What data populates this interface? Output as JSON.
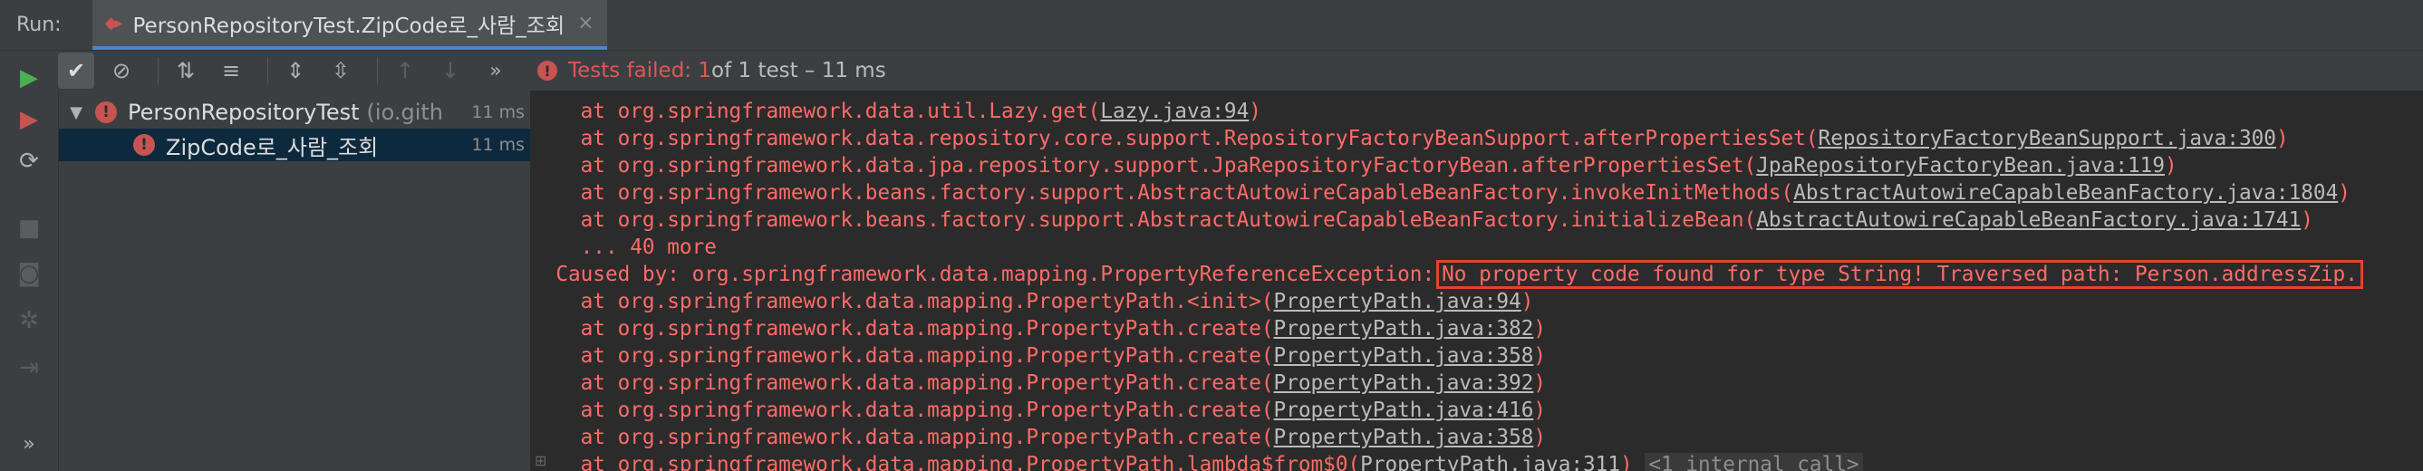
{
  "tabbar": {
    "run_label": "Run:",
    "tab_title": "PersonRepositoryTest.ZipCode로_사람_조회",
    "tab_close": "×"
  },
  "toolbar": {
    "more": "»",
    "status_failed": "Tests failed: 1",
    "status_rest": " of 1 test – 11 ms"
  },
  "leftbar": {
    "more": "»"
  },
  "tree": {
    "root": {
      "name": "PersonRepositoryTest",
      "pkg": "(io.gith",
      "time": "11 ms"
    },
    "child": {
      "name": "ZipCode로_사람_조회",
      "time": "11 ms"
    }
  },
  "console": {
    "lines": [
      {
        "pre": "    at org.springframework.data.util.Lazy.get(",
        "link": "Lazy.java:94",
        "post": ")"
      },
      {
        "pre": "    at org.springframework.data.repository.core.support.RepositoryFactoryBeanSupport.afterPropertiesSet(",
        "link": "RepositoryFactoryBeanSupport.java:300",
        "post": ")"
      },
      {
        "pre": "    at org.springframework.data.jpa.repository.support.JpaRepositoryFactoryBean.afterPropertiesSet(",
        "link": "JpaRepositoryFactoryBean.java:119",
        "post": ")"
      },
      {
        "pre": "    at org.springframework.beans.factory.support.AbstractAutowireCapableBeanFactory.invokeInitMethods(",
        "link": "AbstractAutowireCapableBeanFactory.java:1804",
        "post": ")"
      },
      {
        "pre": "    at org.springframework.beans.factory.support.AbstractAutowireCapableBeanFactory.initializeBean(",
        "link": "AbstractAutowireCapableBeanFactory.java:1741",
        "post": ")"
      },
      {
        "pre": "    ... 40 more",
        "link": "",
        "post": ""
      }
    ],
    "caused_by_prefix": "  Caused by: org.springframework.data.mapping.PropertyReferenceException:",
    "caused_by_message": "No property code found for type String! Traversed path: Person.addressZip.",
    "lines2": [
      {
        "pre": "    at org.springframework.data.mapping.PropertyPath.<init>(",
        "link": "PropertyPath.java:94",
        "post": ")"
      },
      {
        "pre": "    at org.springframework.data.mapping.PropertyPath.create(",
        "link": "PropertyPath.java:382",
        "post": ")"
      },
      {
        "pre": "    at org.springframework.data.mapping.PropertyPath.create(",
        "link": "PropertyPath.java:358",
        "post": ")"
      },
      {
        "pre": "    at org.springframework.data.mapping.PropertyPath.create(",
        "link": "PropertyPath.java:392",
        "post": ")"
      },
      {
        "pre": "    at org.springframework.data.mapping.PropertyPath.create(",
        "link": "PropertyPath.java:416",
        "post": ")"
      },
      {
        "pre": "    at org.springframework.data.mapping.PropertyPath.create(",
        "link": "PropertyPath.java:358",
        "post": ")"
      }
    ],
    "last_line": {
      "pre": "    at org.springframework.data.mapping.PropertyPath.lambda$from$0(",
      "link": "PropertyPath.java:311",
      "post": ")",
      "fold": "<1 internal call>"
    }
  },
  "colors": {
    "error_red": "#ff6b68",
    "highlight_box": "#e2442a",
    "background": "#2b2b2b",
    "panel": "#3c3f41"
  }
}
